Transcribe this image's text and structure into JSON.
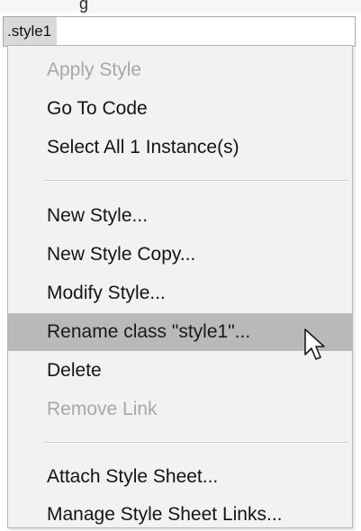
{
  "top_fragment": "g",
  "style_field": {
    "selected_style": ".style1"
  },
  "menu": {
    "group1": [
      {
        "label": "Apply Style",
        "enabled": false
      },
      {
        "label": "Go To Code",
        "enabled": true
      },
      {
        "label": "Select All 1 Instance(s)",
        "enabled": true
      }
    ],
    "group2": [
      {
        "label": "New Style...",
        "enabled": true
      },
      {
        "label": "New Style Copy...",
        "enabled": true
      },
      {
        "label": "Modify Style...",
        "enabled": true
      },
      {
        "label": "Rename class \"style1\"...",
        "enabled": true,
        "highlighted": true
      },
      {
        "label": "Delete",
        "enabled": true
      },
      {
        "label": "Remove Link",
        "enabled": false
      }
    ],
    "group3": [
      {
        "label": "Attach Style Sheet...",
        "enabled": true
      },
      {
        "label": "Manage Style Sheet Links...",
        "enabled": true
      }
    ]
  },
  "colors": {
    "menu_background": "#f2f2f2",
    "highlight": "#b9b9b9",
    "disabled_text": "#a7a7a7",
    "text": "#141414"
  },
  "cursor": "arrow-pointer-icon"
}
